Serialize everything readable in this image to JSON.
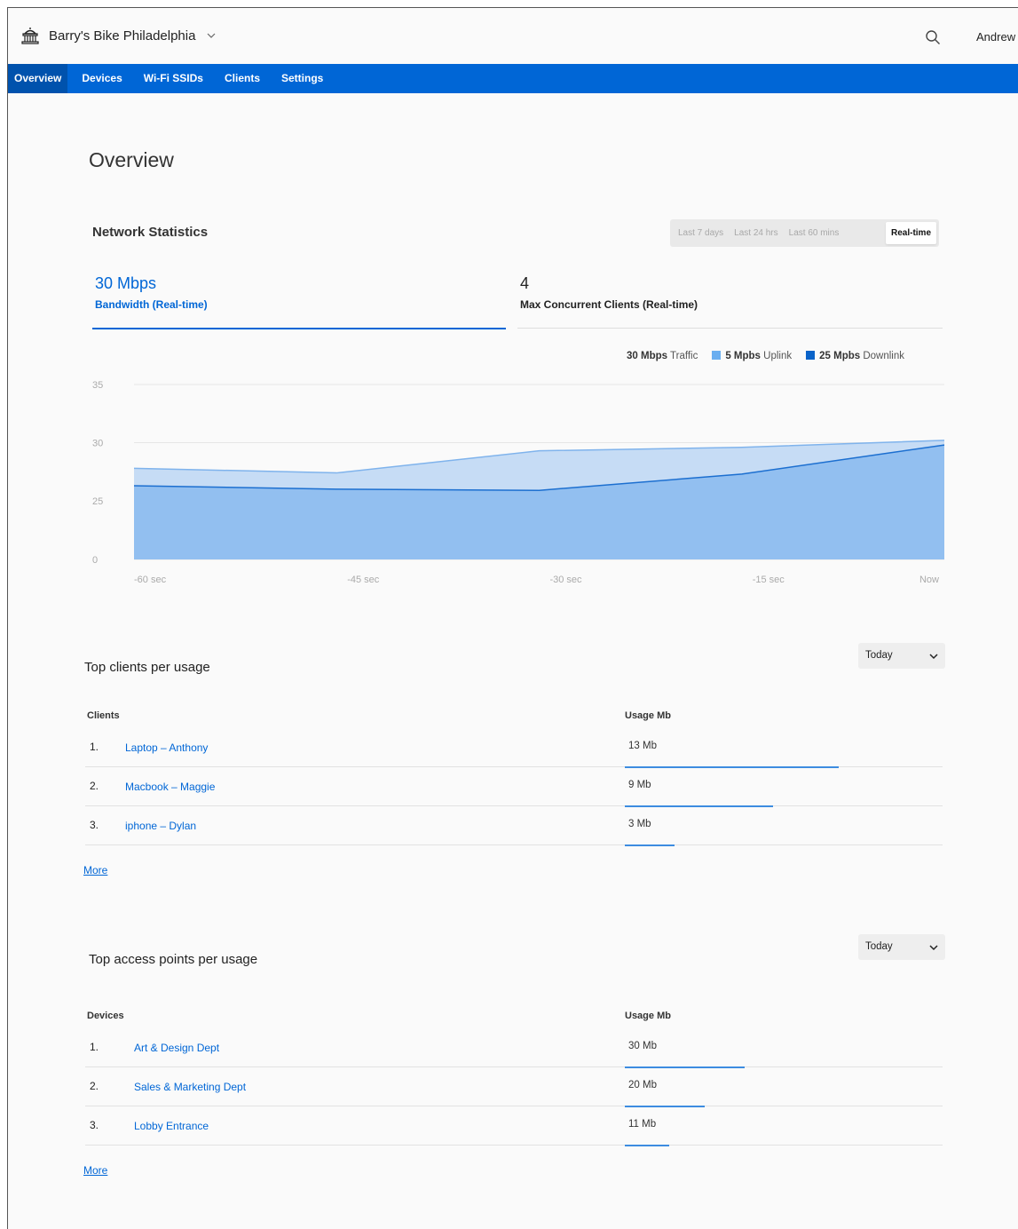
{
  "header": {
    "org_name": "Barry's Bike Philadelphia",
    "user_name": "Andrew"
  },
  "nav": {
    "items": [
      "Overview",
      "Devices",
      "Wi-Fi SSIDs",
      "Clients",
      "Settings"
    ],
    "active": "Overview"
  },
  "page": {
    "title": "Overview"
  },
  "network_stats": {
    "title": "Network Statistics",
    "ranges": [
      "Last 7 days",
      "Last 24 hrs",
      "Last 60 mins",
      "Real-time"
    ],
    "selected_range": "Real-time",
    "tabs": [
      {
        "value": "30 Mbps",
        "label": "Bandwidth (Real-time)"
      },
      {
        "value": "4",
        "label": "Max Concurrent Clients (Real-time)"
      }
    ],
    "legend": {
      "traffic_value": "30 Mbps",
      "traffic_label": "Traffic",
      "uplink_value": "5 Mpbs",
      "uplink_label": "Uplink",
      "downlink_value": "25 Mpbs",
      "downlink_label": "Downlink"
    }
  },
  "chart_data": {
    "type": "area",
    "x": [
      "-60 sec",
      "-45 sec",
      "-30 sec",
      "-15 sec",
      "Now"
    ],
    "y_ticks": [
      35,
      30,
      25,
      0
    ],
    "series": [
      {
        "name": "Uplink",
        "x": [
          -60,
          -45,
          -30,
          -15,
          0
        ],
        "values": [
          27.8,
          27.4,
          29.3,
          29.6,
          30.2
        ],
        "color": "#c6dcf5"
      },
      {
        "name": "Downlink",
        "x": [
          -60,
          -45,
          -30,
          -15,
          0
        ],
        "values": [
          26.3,
          26.0,
          25.9,
          27.3,
          29.8
        ],
        "color": "#92bff0"
      }
    ],
    "legend_position": "top-right",
    "grid": true,
    "colors": {
      "uplink_swatch": "#6aaef0",
      "downlink_swatch": "#0a63c9",
      "line": "#1c6fd0"
    }
  },
  "top_clients": {
    "title": "Top clients per usage",
    "period": "Today",
    "col_name": "Clients",
    "col_usage": "Usage Mb",
    "rows": [
      {
        "rank": "1.",
        "name": "Laptop – Anthony",
        "usage": "13 Mb",
        "mb": 13
      },
      {
        "rank": "2.",
        "name": "Macbook – Maggie",
        "usage": "9 Mb",
        "mb": 9
      },
      {
        "rank": "3.",
        "name": "iphone – Dylan",
        "usage": "3 Mb",
        "mb": 3
      }
    ],
    "more": "More"
  },
  "top_aps": {
    "title": "Top access points per usage",
    "period": "Today",
    "col_name": "Devices",
    "col_usage": "Usage Mb",
    "rows": [
      {
        "rank": "1.",
        "name": "Art & Design Dept",
        "usage": "30 Mb",
        "mb": 30
      },
      {
        "rank": "2.",
        "name": "Sales & Marketing Dept",
        "usage": "20 Mb",
        "mb": 20
      },
      {
        "rank": "3.",
        "name": "Lobby Entrance",
        "usage": "11 Mb",
        "mb": 11
      }
    ],
    "more": "More"
  }
}
